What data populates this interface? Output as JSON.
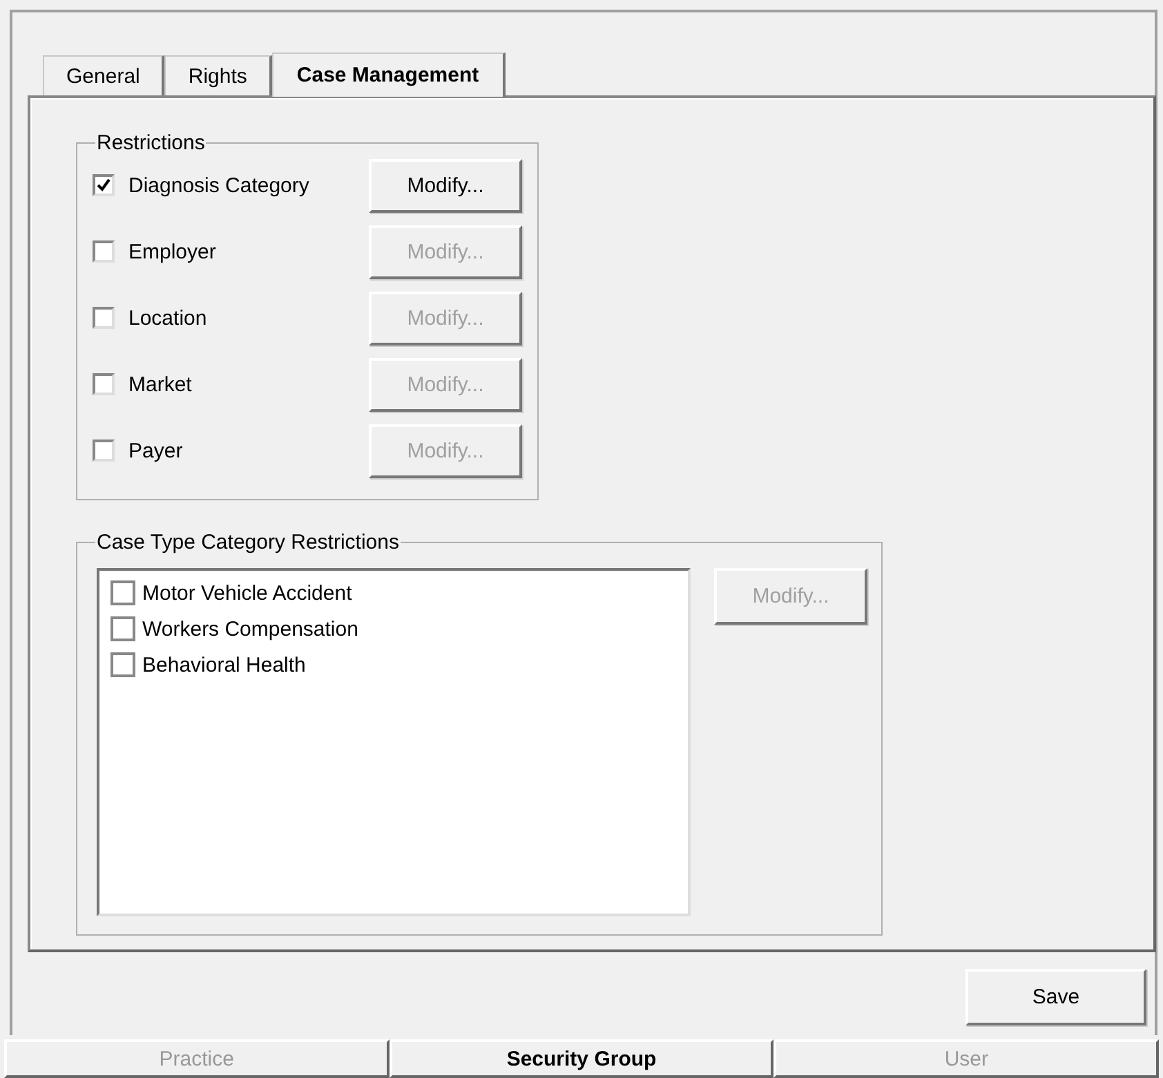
{
  "tabs": [
    {
      "label": "General",
      "selected": false
    },
    {
      "label": "Rights",
      "selected": false
    },
    {
      "label": "Case Management",
      "selected": true
    }
  ],
  "restrictions": {
    "title": "Restrictions",
    "items": [
      {
        "label": "Diagnosis Category",
        "checked": true,
        "button": "Modify...",
        "disabled": false
      },
      {
        "label": "Employer",
        "checked": false,
        "button": "Modify...",
        "disabled": true
      },
      {
        "label": "Location",
        "checked": false,
        "button": "Modify...",
        "disabled": true
      },
      {
        "label": "Market",
        "checked": false,
        "button": "Modify...",
        "disabled": true
      },
      {
        "label": "Payer",
        "checked": false,
        "button": "Modify...",
        "disabled": true
      }
    ]
  },
  "case_type": {
    "title": "Case Type Category Restrictions",
    "items": [
      {
        "label": "Motor Vehicle Accident",
        "checked": false
      },
      {
        "label": "Workers Compensation",
        "checked": false
      },
      {
        "label": "Behavioral Health",
        "checked": false
      }
    ],
    "button": "Modify...",
    "button_disabled": true
  },
  "save_button": "Save",
  "bottom_tabs": [
    {
      "label": "Practice",
      "selected": false
    },
    {
      "label": "Security Group",
      "selected": true
    },
    {
      "label": "User",
      "selected": false
    }
  ]
}
